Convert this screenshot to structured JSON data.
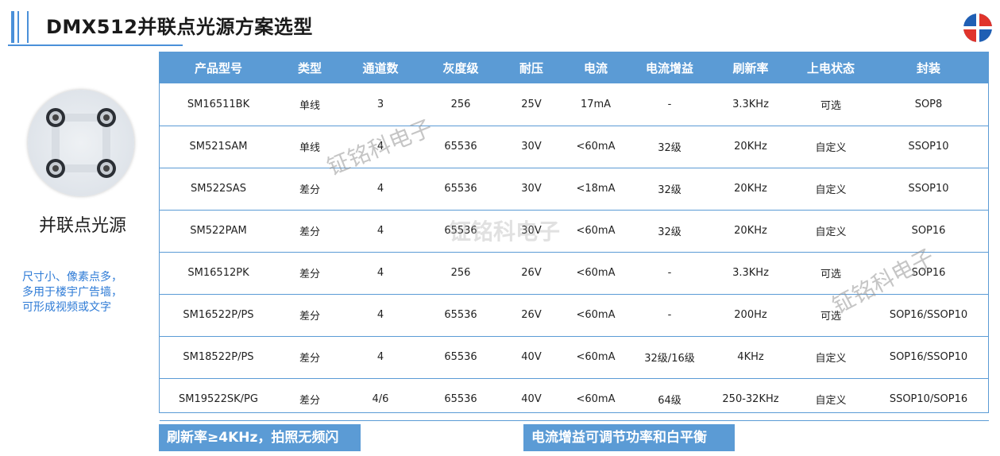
{
  "title": "DMX512并联点光源方案选型",
  "left_panel": {
    "product_name": "并联点光源",
    "description": [
      "尺寸小、像素点多，",
      "多用于楼宇广告墙，",
      "可形成视频或文字"
    ]
  },
  "table": {
    "headers": [
      "产品型号",
      "类型",
      "通道数",
      "灰度级",
      "耐压",
      "电流",
      "电流增益",
      "刷新率",
      "上电状态",
      "封装"
    ],
    "rows": [
      [
        "SM16511BK",
        "单线",
        "3",
        "256",
        "25V",
        "17mA",
        "-",
        "3.3KHz",
        "可选",
        "SOP8"
      ],
      [
        "SM521SAM",
        "单线",
        "4",
        "65536",
        "30V",
        "<60mA",
        "32级",
        "20KHz",
        "自定义",
        "SSOP10"
      ],
      [
        "SM522SAS",
        "差分",
        "4",
        "65536",
        "30V",
        "<18mA",
        "32级",
        "20KHz",
        "自定义",
        "SSOP10"
      ],
      [
        "SM522PAM",
        "差分",
        "4",
        "65536",
        "30V",
        "<60mA",
        "32级",
        "20KHz",
        "自定义",
        "SOP16"
      ],
      [
        "SM16512PK",
        "差分",
        "4",
        "256",
        "26V",
        "<60mA",
        "-",
        "3.3KHz",
        "可选",
        "SOP16"
      ],
      [
        "SM16522P/PS",
        "差分",
        "4",
        "65536",
        "26V",
        "<60mA",
        "-",
        "200Hz",
        "可选",
        "SOP16/SSOP10"
      ],
      [
        "SM18522P/PS",
        "差分",
        "4",
        "65536",
        "40V",
        "<60mA",
        "32级/16级",
        "4KHz",
        "自定义",
        "SOP16/SSOP10"
      ],
      [
        "SM19522SK/PG",
        "差分",
        "4/6",
        "65536",
        "40V",
        "<60mA",
        "64级",
        "250-32KHz",
        "自定义",
        "SSOP10/SOP16"
      ]
    ]
  },
  "notes": {
    "left": "刷新率≥4KHz，拍照无频闪",
    "right": "电流增益可调节功率和白平衡"
  },
  "watermarks": [
    "钲铭科电子",
    "钲铭科电子",
    "钲铭科电子"
  ],
  "colors": {
    "accent": "#5b9bd5",
    "desc_text": "#2e7bd6",
    "logo_red": "#e0342b",
    "logo_blue": "#1f5fb4"
  },
  "icons": {
    "logo": "company-logo-icon",
    "product": "led-point-light-image"
  }
}
